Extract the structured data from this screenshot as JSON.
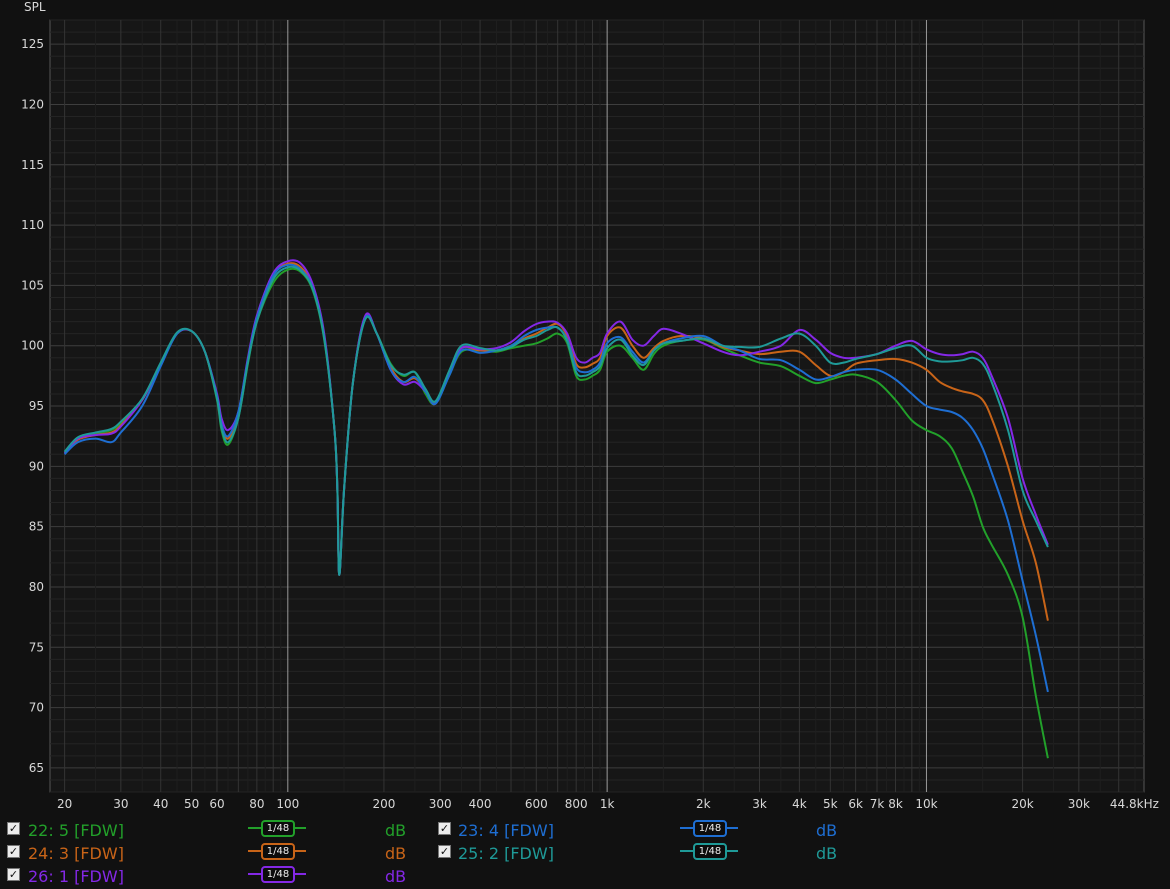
{
  "chart_data": {
    "type": "line",
    "title": "",
    "ylabel": "SPL",
    "xlabel": "",
    "xscale": "log",
    "xlim": [
      18,
      48000
    ],
    "ylim": [
      63,
      127
    ],
    "grid": true,
    "x_tick_labels": [
      {
        "v": 20,
        "t": "20"
      },
      {
        "v": 30,
        "t": "30"
      },
      {
        "v": 40,
        "t": "40"
      },
      {
        "v": 50,
        "t": "50"
      },
      {
        "v": 60,
        "t": "60"
      },
      {
        "v": 80,
        "t": "80"
      },
      {
        "v": 100,
        "t": "100"
      },
      {
        "v": 200,
        "t": "200"
      },
      {
        "v": 300,
        "t": "300"
      },
      {
        "v": 400,
        "t": "400"
      },
      {
        "v": 600,
        "t": "600"
      },
      {
        "v": 800,
        "t": "800"
      },
      {
        "v": 1000,
        "t": "1k"
      },
      {
        "v": 2000,
        "t": "2k"
      },
      {
        "v": 3000,
        "t": "3k"
      },
      {
        "v": 4000,
        "t": "4k"
      },
      {
        "v": 5000,
        "t": "5k"
      },
      {
        "v": 6000,
        "t": "6k"
      },
      {
        "v": 7000,
        "t": "7k"
      },
      {
        "v": 8000,
        "t": "8k"
      },
      {
        "v": 10000,
        "t": "10k"
      },
      {
        "v": 20000,
        "t": "20k"
      },
      {
        "v": 30000,
        "t": "30k"
      },
      {
        "v": 44800,
        "t": "44.8kHz"
      }
    ],
    "y_ticks": [
      65,
      70,
      75,
      80,
      85,
      90,
      95,
      100,
      105,
      110,
      115,
      120,
      125
    ],
    "series": [
      {
        "name": "22: 5 [FDW]",
        "color": "#22a02a",
        "x": [
          20,
          22,
          25,
          28,
          30,
          35,
          40,
          45,
          50,
          55,
          60,
          62,
          65,
          70,
          75,
          80,
          90,
          100,
          110,
          120,
          130,
          140,
          143,
          145,
          150,
          160,
          175,
          190,
          210,
          230,
          250,
          270,
          290,
          320,
          350,
          400,
          450,
          500,
          550,
          600,
          650,
          700,
          750,
          800,
          850,
          900,
          950,
          1000,
          1100,
          1200,
          1300,
          1400,
          1500,
          1700,
          2000,
          2300,
          2600,
          3000,
          3500,
          4000,
          4500,
          5000,
          5500,
          6000,
          7000,
          8000,
          9000,
          10000,
          11000,
          12000,
          13000,
          14000,
          15000,
          16000,
          18000,
          20000,
          22000,
          24000
        ],
        "y": [
          91.2,
          92.3,
          92.7,
          93.0,
          93.6,
          95.5,
          98.5,
          101.0,
          101.2,
          99.5,
          95.5,
          93.0,
          91.8,
          94.0,
          98.5,
          102.0,
          105.2,
          106.3,
          106.1,
          104.5,
          100.5,
          93.0,
          88.0,
          81.0,
          88.0,
          97.0,
          102.3,
          101.0,
          98.5,
          97.5,
          97.8,
          96.0,
          95.2,
          97.5,
          99.5,
          99.6,
          99.5,
          99.8,
          100.0,
          100.2,
          100.6,
          101.0,
          100.2,
          97.5,
          97.2,
          97.5,
          98.0,
          99.5,
          100.0,
          99.0,
          98.0,
          99.3,
          100.0,
          100.4,
          100.5,
          99.8,
          99.2,
          98.6,
          98.3,
          97.5,
          96.9,
          97.2,
          97.5,
          97.6,
          97.0,
          95.5,
          93.8,
          93.0,
          92.5,
          91.5,
          89.5,
          87.5,
          85.0,
          83.5,
          81.0,
          77.5,
          71.0,
          65.8
        ]
      },
      {
        "name": "24: 3 [FDW]",
        "color": "#c86418",
        "x": [
          20,
          22,
          25,
          28,
          30,
          35,
          40,
          45,
          50,
          55,
          60,
          62,
          65,
          70,
          75,
          80,
          90,
          100,
          110,
          120,
          130,
          140,
          143,
          145,
          150,
          160,
          175,
          190,
          210,
          230,
          250,
          270,
          290,
          320,
          350,
          400,
          450,
          500,
          550,
          600,
          650,
          700,
          750,
          800,
          850,
          900,
          950,
          1000,
          1100,
          1200,
          1300,
          1400,
          1500,
          1700,
          2000,
          2300,
          2600,
          3000,
          3500,
          4000,
          4500,
          5000,
          5500,
          6000,
          7000,
          8000,
          9000,
          10000,
          11000,
          12000,
          13000,
          14000,
          15000,
          16000,
          18000,
          20000,
          22000,
          24000
        ],
        "y": [
          91.1,
          92.2,
          92.6,
          92.8,
          93.4,
          95.5,
          98.5,
          101.0,
          101.2,
          99.5,
          95.7,
          93.5,
          92.3,
          94.3,
          98.8,
          102.2,
          105.8,
          106.8,
          106.5,
          104.8,
          100.8,
          93.0,
          88.0,
          81.0,
          88.0,
          97.0,
          102.4,
          101.0,
          98.2,
          97.0,
          97.3,
          96.3,
          95.3,
          97.8,
          99.8,
          99.6,
          99.6,
          100.0,
          100.6,
          101.0,
          101.5,
          101.8,
          100.8,
          98.5,
          98.2,
          98.5,
          99.0,
          100.8,
          101.5,
          100.0,
          99.0,
          99.8,
          100.4,
          100.8,
          100.6,
          99.9,
          99.6,
          99.3,
          99.5,
          99.5,
          98.4,
          97.5,
          97.8,
          98.5,
          98.8,
          98.9,
          98.6,
          98.0,
          97.0,
          96.5,
          96.2,
          96.0,
          95.5,
          94.0,
          90.0,
          85.5,
          82.0,
          77.2
        ]
      },
      {
        "name": "26: 1 [FDW]",
        "color": "#8428e6",
        "x": [
          20,
          22,
          25,
          28,
          30,
          35,
          40,
          45,
          50,
          55,
          60,
          62,
          65,
          70,
          75,
          80,
          90,
          100,
          110,
          120,
          130,
          140,
          143,
          145,
          150,
          160,
          175,
          190,
          210,
          230,
          250,
          270,
          290,
          320,
          350,
          400,
          450,
          500,
          550,
          600,
          650,
          700,
          750,
          800,
          850,
          900,
          950,
          1000,
          1100,
          1200,
          1300,
          1400,
          1500,
          1700,
          2000,
          2300,
          2600,
          3000,
          3500,
          4000,
          4500,
          5000,
          5500,
          6000,
          7000,
          8000,
          9000,
          10000,
          11000,
          12000,
          13000,
          14000,
          15000,
          16000,
          18000,
          20000,
          22000,
          24000
        ],
        "y": [
          91.1,
          92.3,
          92.6,
          92.7,
          93.3,
          95.5,
          98.5,
          101.0,
          101.2,
          99.5,
          96.0,
          94.0,
          93.0,
          94.5,
          99.0,
          102.5,
          106.0,
          107.0,
          106.8,
          105.0,
          101.0,
          93.0,
          88.0,
          81.0,
          88.0,
          97.0,
          102.5,
          101.0,
          98.0,
          96.8,
          97.0,
          96.2,
          95.2,
          97.8,
          99.8,
          99.7,
          99.8,
          100.3,
          101.2,
          101.8,
          102.0,
          101.9,
          101.0,
          99.0,
          98.6,
          99.0,
          99.4,
          101.0,
          102.0,
          100.5,
          100.0,
          100.8,
          101.4,
          101.0,
          100.2,
          99.5,
          99.2,
          99.5,
          100.0,
          101.3,
          100.5,
          99.4,
          99.0,
          99.0,
          99.3,
          100.0,
          100.4,
          99.7,
          99.3,
          99.2,
          99.3,
          99.5,
          99.0,
          97.5,
          94.0,
          89.0,
          86.0,
          83.5
        ]
      },
      {
        "name": "23: 4 [FDW]",
        "color": "#1e6ed2",
        "x": [
          20,
          22,
          25,
          28,
          30,
          35,
          40,
          45,
          50,
          55,
          60,
          62,
          65,
          70,
          75,
          80,
          90,
          100,
          110,
          120,
          130,
          140,
          143,
          145,
          150,
          160,
          175,
          190,
          210,
          230,
          250,
          270,
          290,
          320,
          350,
          400,
          450,
          500,
          550,
          600,
          650,
          700,
          750,
          800,
          850,
          900,
          950,
          1000,
          1100,
          1200,
          1300,
          1400,
          1500,
          1700,
          2000,
          2300,
          2600,
          3000,
          3500,
          4000,
          4500,
          5000,
          5500,
          6000,
          7000,
          8000,
          9000,
          10000,
          11000,
          12000,
          13000,
          14000,
          15000,
          16000,
          18000,
          20000,
          22000,
          24000
        ],
        "y": [
          91.0,
          92.0,
          92.3,
          92.0,
          92.8,
          95.0,
          98.3,
          101.0,
          101.2,
          99.5,
          95.8,
          93.5,
          92.5,
          94.5,
          98.8,
          102.3,
          105.8,
          106.7,
          106.3,
          104.7,
          100.7,
          93.0,
          88.0,
          81.0,
          88.0,
          97.0,
          102.3,
          101.0,
          98.0,
          97.0,
          97.4,
          96.2,
          95.2,
          97.5,
          99.6,
          99.4,
          99.6,
          100.0,
          100.8,
          101.3,
          101.5,
          101.5,
          100.5,
          98.2,
          97.8,
          98.0,
          98.6,
          100.2,
          100.7,
          99.5,
          98.6,
          99.6,
          100.2,
          100.6,
          100.8,
          100.0,
          99.6,
          98.9,
          98.8,
          98.0,
          97.2,
          97.4,
          97.8,
          98.0,
          98.0,
          97.2,
          96.0,
          95.0,
          94.7,
          94.5,
          94.0,
          93.0,
          91.5,
          89.5,
          85.5,
          80.5,
          76.0,
          71.3
        ]
      },
      {
        "name": "25: 2 [FDW]",
        "color": "#1f9a98",
        "x": [
          20,
          22,
          25,
          28,
          30,
          35,
          40,
          45,
          50,
          55,
          60,
          62,
          65,
          70,
          75,
          80,
          90,
          100,
          110,
          120,
          130,
          140,
          143,
          145,
          150,
          160,
          175,
          190,
          210,
          230,
          250,
          270,
          290,
          320,
          350,
          400,
          450,
          500,
          550,
          600,
          650,
          700,
          750,
          800,
          850,
          900,
          950,
          1000,
          1100,
          1200,
          1300,
          1400,
          1500,
          1700,
          2000,
          2300,
          2600,
          3000,
          3500,
          4000,
          4500,
          5000,
          5500,
          6000,
          7000,
          8000,
          9000,
          10000,
          11000,
          12000,
          13000,
          14000,
          15000,
          16000,
          18000,
          20000,
          22000,
          24000
        ],
        "y": [
          91.2,
          92.4,
          92.8,
          93.1,
          93.7,
          95.6,
          98.6,
          101.1,
          101.2,
          99.5,
          95.6,
          93.2,
          92.0,
          94.0,
          98.6,
          102.0,
          105.5,
          106.5,
          106.2,
          104.6,
          100.6,
          93.0,
          88.0,
          81.0,
          88.0,
          97.0,
          102.2,
          101.0,
          98.4,
          97.6,
          97.8,
          96.4,
          95.4,
          97.9,
          100.0,
          99.8,
          99.6,
          99.9,
          100.5,
          100.8,
          101.3,
          101.5,
          100.4,
          97.8,
          97.5,
          97.8,
          98.3,
          99.8,
          100.5,
          99.2,
          98.4,
          99.6,
          100.2,
          100.4,
          100.6,
          100.0,
          99.9,
          99.9,
          100.6,
          101.0,
          100.0,
          98.6,
          98.6,
          98.9,
          99.3,
          99.8,
          100.0,
          99.0,
          98.7,
          98.7,
          98.8,
          99.0,
          98.5,
          97.0,
          93.0,
          88.0,
          85.5,
          83.3
        ]
      }
    ]
  },
  "legend": {
    "items": [
      {
        "name": "22: 5 [FDW]",
        "smoothing": "1/48",
        "unit": "dB",
        "color": "#22a02a",
        "checked": "✓"
      },
      {
        "name": "24: 3 [FDW]",
        "smoothing": "1/48",
        "unit": "dB",
        "color": "#c86418",
        "checked": "✓"
      },
      {
        "name": "26: 1 [FDW]",
        "smoothing": "1/48",
        "unit": "dB",
        "color": "#8428e6",
        "checked": "✓"
      },
      {
        "name": "23: 4 [FDW]",
        "smoothing": "1/48",
        "unit": "dB",
        "color": "#1e6ed2",
        "checked": "✓"
      },
      {
        "name": "25: 2 [FDW]",
        "smoothing": "1/48",
        "unit": "dB",
        "color": "#1f9a98",
        "checked": "✓"
      }
    ]
  }
}
